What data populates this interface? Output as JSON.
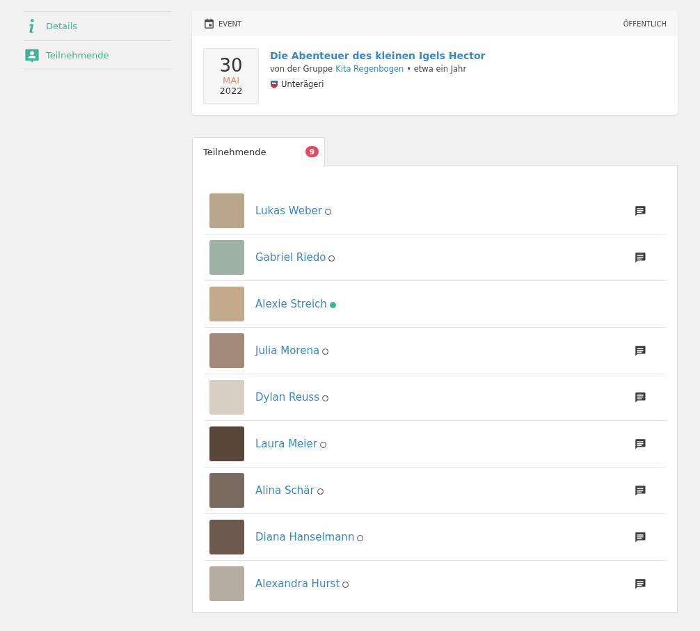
{
  "sidebar": {
    "items": [
      {
        "label": "Details"
      },
      {
        "label": "Teilnehmende"
      }
    ]
  },
  "event": {
    "type_label": "EVENT",
    "visibility": "ÖFFENTLICH",
    "day": "30",
    "month": "MAI",
    "year": "2022",
    "title": "Die Abenteuer des kleinen Igels Hector",
    "byline_prefix": "von der Gruppe",
    "group": "Kita Regenbogen",
    "byline_suffix": "• etwa ein Jahr",
    "location": "Unterägeri"
  },
  "tabs": [
    {
      "label": "Teilnehmende",
      "count": "9",
      "selected": true
    }
  ],
  "participants": [
    {
      "name": "Lukas Weber",
      "online": false,
      "can_message": true
    },
    {
      "name": "Gabriel Riedo",
      "online": false,
      "can_message": true
    },
    {
      "name": "Alexie Streich",
      "online": true,
      "can_message": false
    },
    {
      "name": "Julia Morena",
      "online": false,
      "can_message": true
    },
    {
      "name": "Dylan Reuss",
      "online": false,
      "can_message": true
    },
    {
      "name": "Laura Meier",
      "online": false,
      "can_message": true
    },
    {
      "name": "Alina Schär",
      "online": false,
      "can_message": true
    },
    {
      "name": "Diana Hanselmann",
      "online": false,
      "can_message": true
    },
    {
      "name": "Alexandra Hurst",
      "online": false,
      "can_message": true
    }
  ]
}
